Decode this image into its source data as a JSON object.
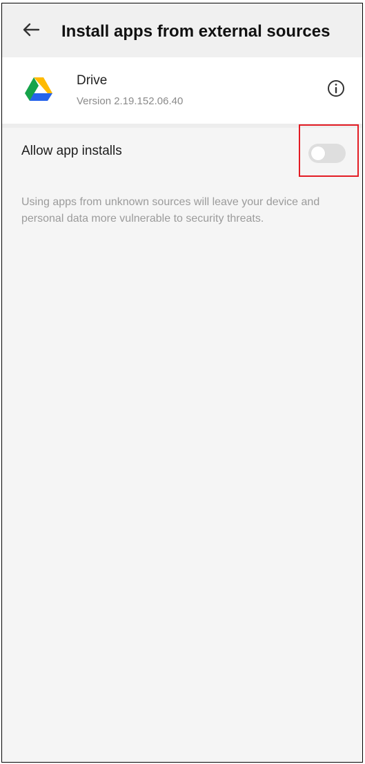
{
  "app_bar": {
    "title": "Install apps from external sources",
    "back_icon": "arrow-left-icon"
  },
  "app": {
    "name": "Drive",
    "version": "Version 2.19.152.06.40",
    "icon": "google-drive-icon",
    "info_icon": "info-icon"
  },
  "setting": {
    "label": "Allow app installs",
    "toggle_state": "off"
  },
  "warning": {
    "text": "Using apps from unknown sources will leave your device and personal data more vulnerable to security threats."
  },
  "colors": {
    "highlight_border": "#e31b23",
    "toggle_track": "#dedede",
    "background": "#f5f5f5",
    "header_background": "#f0f0f0"
  }
}
